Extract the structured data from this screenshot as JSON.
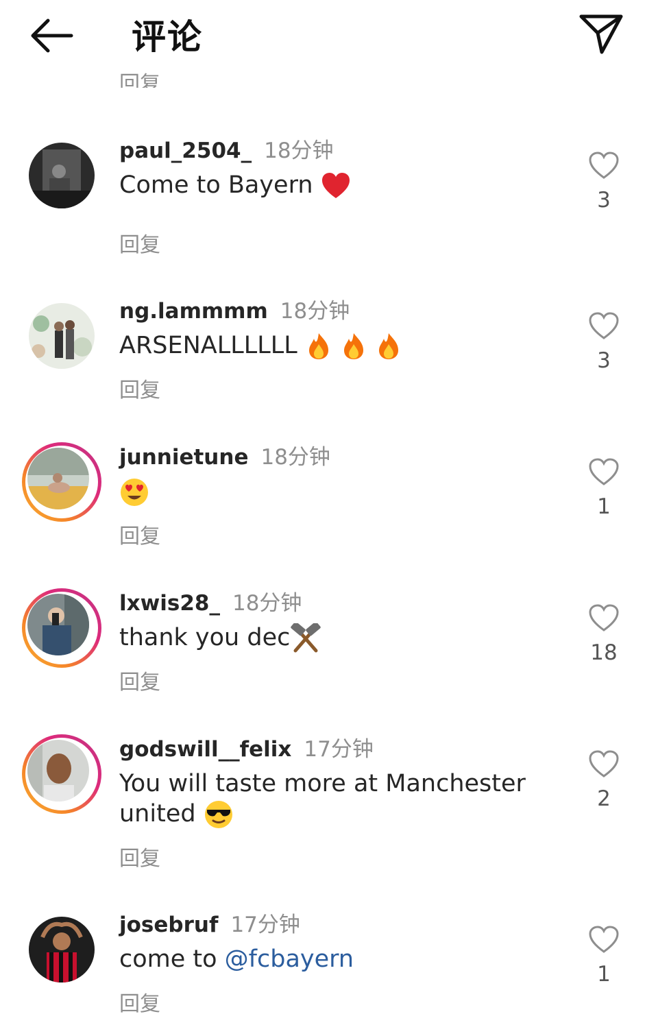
{
  "header": {
    "title": "评论"
  },
  "partial_reply_label": "回复",
  "comments": [
    {
      "username": "paul_2504_",
      "time": "18分钟",
      "text": "Come to Bayern",
      "emoji": "heart",
      "reply_label": "回复",
      "likes": "3",
      "story_ring": false
    },
    {
      "username": "ng.lammmm",
      "time": "18分钟",
      "text": "ARSENALLLLLL",
      "emoji": "fire x3",
      "reply_label": "回复",
      "likes": "3",
      "story_ring": false
    },
    {
      "username": "junnietune",
      "time": "18分钟",
      "text": "",
      "emoji": "heart-eyes",
      "reply_label": "回复",
      "likes": "1",
      "story_ring": true
    },
    {
      "username": "lxwis28_",
      "time": "18分钟",
      "text": "thank you dec",
      "emoji": "hammers",
      "reply_label": "回复",
      "likes": "18",
      "story_ring": true
    },
    {
      "username": "godswill__felix",
      "time": "17分钟",
      "text_line1": "You will taste more at Manchester",
      "text_line2": "united",
      "emoji": "sunglasses",
      "reply_label": "回复",
      "likes": "2",
      "story_ring": true
    },
    {
      "username": "josebruf",
      "time": "17分钟",
      "text_prefix": "come to ",
      "mention": "@fcbayern",
      "reply_label": "回复",
      "likes": "1",
      "story_ring": false
    }
  ],
  "colors": {
    "text": "#262626",
    "secondary": "#8e8e8e",
    "mention": "#2b5d9e",
    "ring_start": "#f9b233",
    "ring_end": "#c13584"
  }
}
